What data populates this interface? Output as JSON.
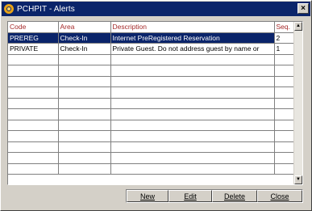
{
  "window": {
    "title": "PCHPIT - Alerts",
    "close_glyph": "×"
  },
  "grid": {
    "columns": [
      "Code",
      "Area",
      "Description",
      "Seq."
    ],
    "rows": [
      {
        "code": "PREREG",
        "area": "Check-In",
        "description": "Internet PreRegistered Reservation",
        "seq": "2"
      },
      {
        "code": "PRIVATE",
        "area": "Check-In",
        "description": "Private Guest.  Do not address guest by name or",
        "seq": "1"
      }
    ],
    "selected_row": 0,
    "scroll_up_glyph": "▲",
    "scroll_down_glyph": "▼"
  },
  "buttons": {
    "new": "New",
    "edit": "Edit",
    "delete": "Delete",
    "close": "Close"
  },
  "colors": {
    "title_bar": "#0a246a",
    "header_text": "#a52a2a",
    "selection": "#0a246a"
  }
}
